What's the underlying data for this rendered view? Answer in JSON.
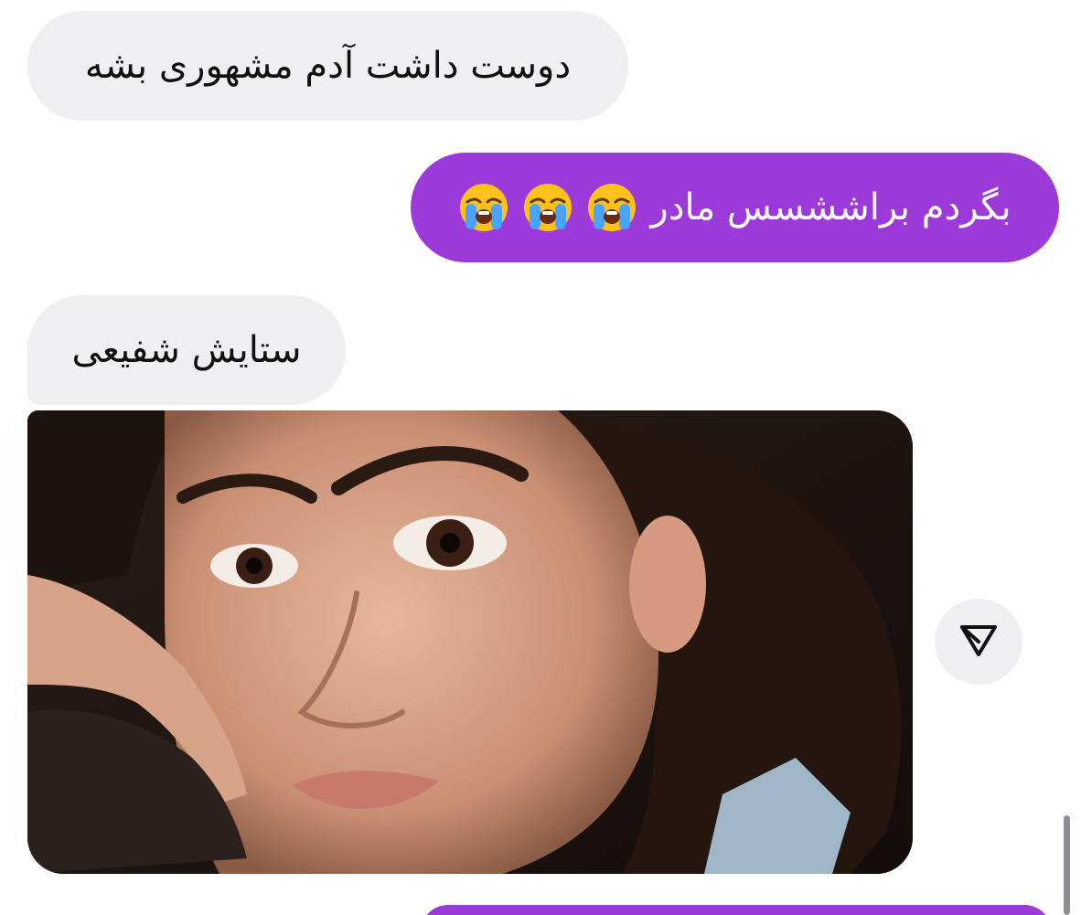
{
  "messages": [
    {
      "id": "msg1",
      "direction": "incoming",
      "text": "دوست داشت آدم مشهوری بشه"
    },
    {
      "id": "msg2",
      "direction": "outgoing",
      "text": "بگردم براششسس مادر",
      "emoji": [
        "loudly-crying-face",
        "loudly-crying-face",
        "loudly-crying-face"
      ]
    },
    {
      "id": "msg3",
      "direction": "incoming",
      "text": "ستایش شفیعی"
    }
  ],
  "photo": {
    "subject": "portrait-photo"
  },
  "share": {
    "icon": "share-icon"
  },
  "colors": {
    "incoming_bubble": "#efeff2",
    "outgoing_bubble": "#9b3ad9",
    "outgoing_text": "#ffffff",
    "incoming_text": "#111111"
  }
}
